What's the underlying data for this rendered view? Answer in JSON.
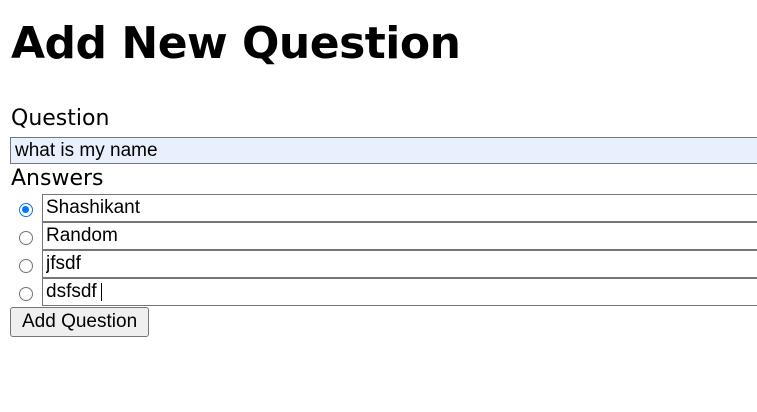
{
  "page": {
    "title": "Add New Question"
  },
  "form": {
    "question_label": "Question",
    "question_value": "what is my name",
    "answers_label": "Answers",
    "answers": [
      {
        "value": "Shashikant",
        "selected": true
      },
      {
        "value": "Random",
        "selected": false
      },
      {
        "value": "jfsdf",
        "selected": false
      },
      {
        "value": "dsfsdf",
        "selected": false
      }
    ],
    "submit_label": "Add Question"
  },
  "colors": {
    "autofill_background": "#e8f0fe",
    "radio_accent": "#0075ff",
    "button_background": "#efefef",
    "border": "#767676"
  }
}
